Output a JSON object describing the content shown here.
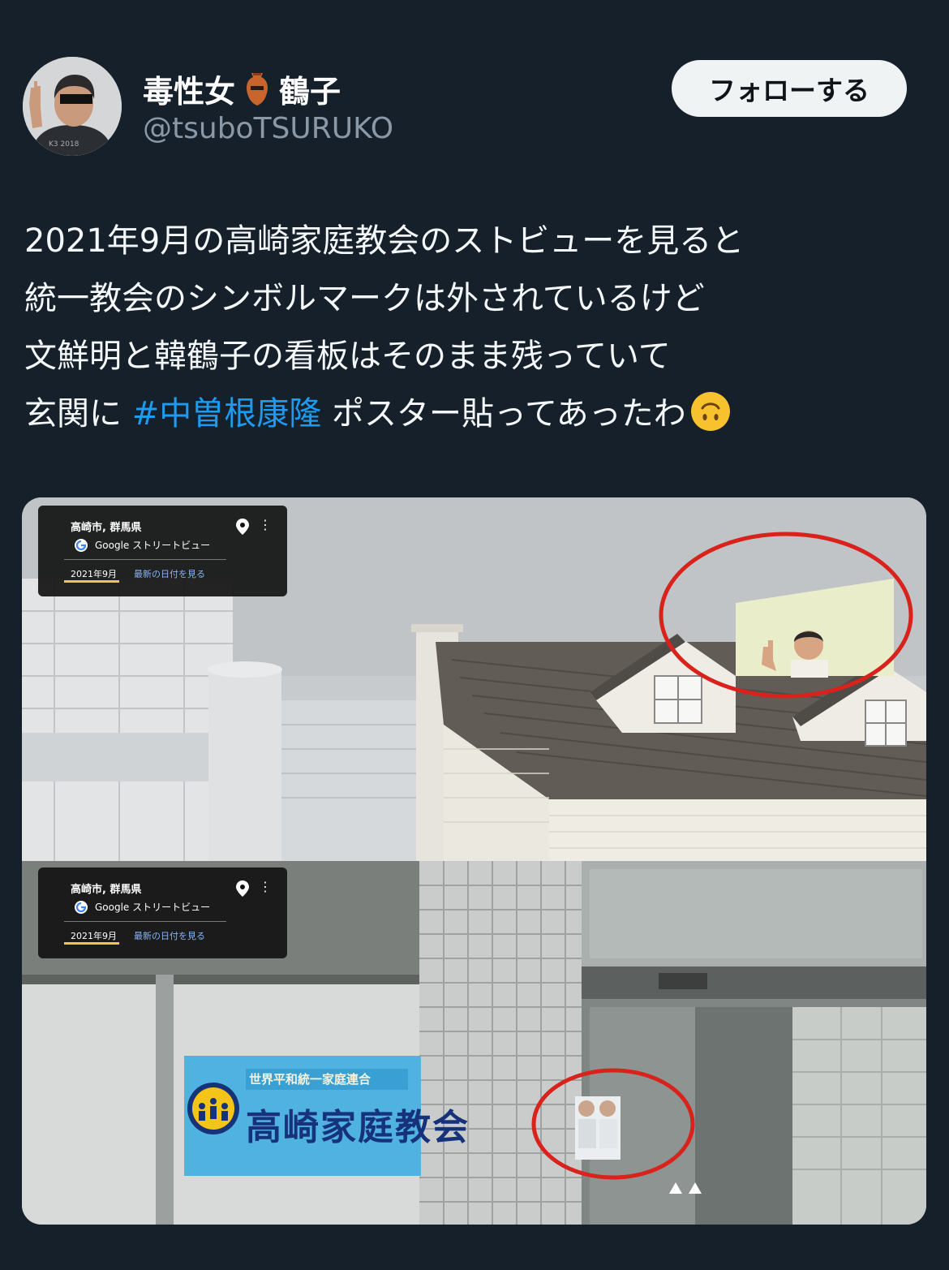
{
  "user": {
    "display_name": "毒性女",
    "display_name_suffix": "鶴子",
    "handle": "@tsuboTSURUKO",
    "name_icon": "amphora-vase-icon"
  },
  "follow_button": {
    "label": "フォローする"
  },
  "tweet": {
    "line1": "2021年9月の高崎家庭教会のストビューを見ると",
    "line2": "統一教会のシンボルマークは外されているけど",
    "line3": "文鮮明と韓鶴子の看板はそのまま残っていて",
    "line4_before": "玄関に ",
    "hashtag": "#中曽根康隆",
    "line4_after": " ポスター貼ってあったわ",
    "emoji": "upside-down-face-emoji"
  },
  "media": {
    "top_overlay": {
      "location": "高崎市, 群馬県",
      "service": "Google ストリートビュー",
      "date": "2021年9月",
      "latest_link": "最新の日付を見る"
    },
    "bottom_overlay": {
      "location": "高崎市, 群馬県",
      "service": "Google ストリートビュー",
      "date": "2021年9月",
      "latest_link": "最新の日付を見る"
    },
    "sign_text_small": "世界平和統一家庭連合",
    "sign_text_main": "高崎家庭教会"
  },
  "colors": {
    "background": "#15202b",
    "hashtag": "#1d9bf0",
    "button_bg": "#eff3f4",
    "handle": "#8b98a5",
    "annotation_circle": "#d9221c"
  }
}
